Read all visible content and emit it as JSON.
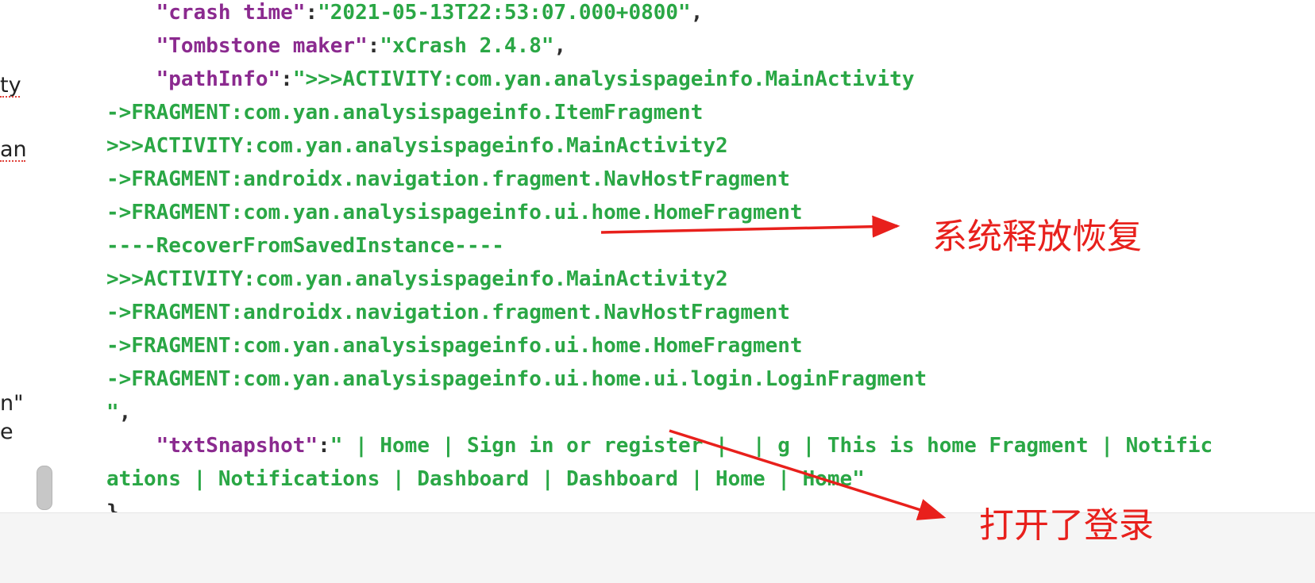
{
  "left_panel": {
    "fragments": [
      "ty",
      "an",
      "n\"",
      "e"
    ]
  },
  "code": {
    "lines": [
      [
        {
          "t": "    \"crash time\"",
          "c": "k"
        },
        {
          "t": ":",
          "c": "p"
        },
        {
          "t": "\"2021-05-13T22:53:07.000+0800\"",
          "c": "s"
        },
        {
          "t": ",",
          "c": "p"
        }
      ],
      [
        {
          "t": "    \"Tombstone maker\"",
          "c": "k"
        },
        {
          "t": ":",
          "c": "p"
        },
        {
          "t": "\"xCrash 2.4.8\"",
          "c": "s"
        },
        {
          "t": ",",
          "c": "p"
        }
      ],
      [
        {
          "t": "    \"pathInfo\"",
          "c": "k"
        },
        {
          "t": ":",
          "c": "p"
        },
        {
          "t": "\">>>ACTIVITY:com.yan.analysispageinfo.MainActivity",
          "c": "s"
        }
      ],
      [
        {
          "t": "->FRAGMENT:com.yan.analysispageinfo.ItemFragment",
          "c": "s"
        }
      ],
      [
        {
          "t": ">>>ACTIVITY:com.yan.analysispageinfo.MainActivity2",
          "c": "s"
        }
      ],
      [
        {
          "t": "->FRAGMENT:androidx.navigation.fragment.NavHostFragment",
          "c": "s"
        }
      ],
      [
        {
          "t": "->FRAGMENT:com.yan.analysispageinfo.ui.home.HomeFragment",
          "c": "s"
        }
      ],
      [
        {
          "t": "----RecoverFromSavedInstance----",
          "c": "s"
        }
      ],
      [
        {
          "t": ">>>ACTIVITY:com.yan.analysispageinfo.MainActivity2",
          "c": "s"
        }
      ],
      [
        {
          "t": "->FRAGMENT:androidx.navigation.fragment.NavHostFragment",
          "c": "s"
        }
      ],
      [
        {
          "t": "->FRAGMENT:com.yan.analysispageinfo.ui.home.HomeFragment",
          "c": "s"
        }
      ],
      [
        {
          "t": "->FRAGMENT:com.yan.analysispageinfo.ui.home.ui.login.LoginFragment",
          "c": "s"
        }
      ],
      [
        {
          "t": "\"",
          "c": "s"
        },
        {
          "t": ",",
          "c": "p"
        }
      ],
      [
        {
          "t": "    \"txtSnapshot\"",
          "c": "k"
        },
        {
          "t": ":",
          "c": "p"
        },
        {
          "t": "\" | Home | Sign in or register |  | g | This is home Fragment | Notific",
          "c": "s"
        }
      ],
      [
        {
          "t": "ations | Notifications | Dashboard | Dashboard | Home | Home\"",
          "c": "s"
        }
      ],
      [
        {
          "t": "}",
          "c": "p"
        }
      ]
    ]
  },
  "annotations": {
    "label_1": "系统释放恢复",
    "label_2": "打开了登录",
    "color": "#e8201c"
  },
  "colors": {
    "key": "#8b2a8f",
    "string": "#2aa745",
    "punct": "#2d2d2d"
  }
}
